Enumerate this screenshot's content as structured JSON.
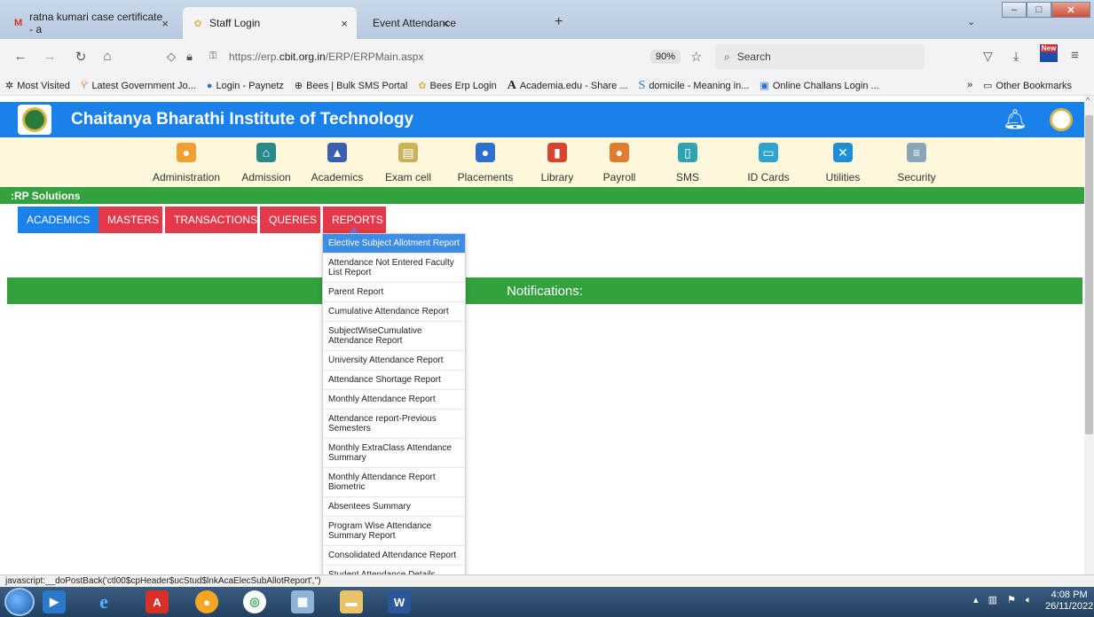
{
  "browser": {
    "tabs": [
      {
        "title": "ratna kumari case certificate - a",
        "icon": "gmail-icon"
      },
      {
        "title": "Staff Login",
        "icon": "cbit-icon"
      },
      {
        "title": "Event Attendance",
        "icon": ""
      }
    ],
    "url_prefix": "https://erp.",
    "url_domain": "cbit.org.in",
    "url_path": "/ERP/ERPMain.aspx",
    "zoom": "90%",
    "search_placeholder": "Search"
  },
  "bookmarks": [
    {
      "label": "Most Visited",
      "icon": "gear-icon"
    },
    {
      "label": "Latest Government Jo...",
      "icon": "job-icon"
    },
    {
      "label": "Login - Paynetz",
      "icon": "paynetz-icon"
    },
    {
      "label": "Bees | Bulk SMS Portal",
      "icon": "globe-icon"
    },
    {
      "label": "Bees Erp Login",
      "icon": "bees-icon"
    },
    {
      "label": "Academia.edu - Share ...",
      "icon": "academia-icon"
    },
    {
      "label": "domicile - Meaning in...",
      "icon": "s-icon"
    },
    {
      "label": "Online Challans Login ...",
      "icon": "challan-icon"
    }
  ],
  "other_bookmarks": "Other Bookmarks",
  "app": {
    "title": "Chaitanya Bharathi Institute of Technology",
    "section_label": ":RP Solutions",
    "modules": [
      {
        "label": "Administration",
        "color": "#f0a030"
      },
      {
        "label": "Admission",
        "color": "#2a8a8a"
      },
      {
        "label": "Academics",
        "color": "#3a5fb0"
      },
      {
        "label": "Exam cell",
        "color": "#c9b25a"
      },
      {
        "label": "Placements",
        "color": "#2f6fcf"
      },
      {
        "label": "Library",
        "color": "#d8452e"
      },
      {
        "label": "Payroll",
        "color": "#e07b30"
      },
      {
        "label": "SMS",
        "color": "#2fa3b0"
      },
      {
        "label": "ID Cards",
        "color": "#2fa3d0"
      },
      {
        "label": "Utilities",
        "color": "#1e8fd6"
      },
      {
        "label": "Security",
        "color": "#8aa4b8"
      }
    ],
    "menu": [
      {
        "label": "ACADEMICS",
        "style": "blue"
      },
      {
        "label": "MASTERS",
        "style": "red"
      },
      {
        "label": "TRANSACTIONS",
        "style": "red"
      },
      {
        "label": "QUERIES",
        "style": "red"
      },
      {
        "label": "REPORTS",
        "style": "red"
      }
    ],
    "notifications_title": "Notifications:",
    "reports_dropdown": [
      "Elective Subject Allotment Report",
      "Attendance Not Entered Faculty List Report",
      "Parent Report",
      "Cumulative Attendance Report",
      "SubjectWiseCumulative Attendance Report",
      "University Attendance Report",
      "Attendance Shortage Report",
      "Monthly Attendance Report",
      "Attendance report-Previous Semesters",
      "Monthly ExtraClass Attendance Summary",
      "Monthly Attendance Report Biometric",
      "Absentees Summary",
      "Program Wise Attendance Summary Report",
      "Consolidated Attendance Report",
      "Student Attendance Details"
    ]
  },
  "status_text": "javascript:__doPostBack('ctl00$cpHeader$ucStud$lnkAcaElecSubAllotReport','')",
  "taskbar": {
    "time": "4:08 PM",
    "date": "26/11/2022"
  }
}
